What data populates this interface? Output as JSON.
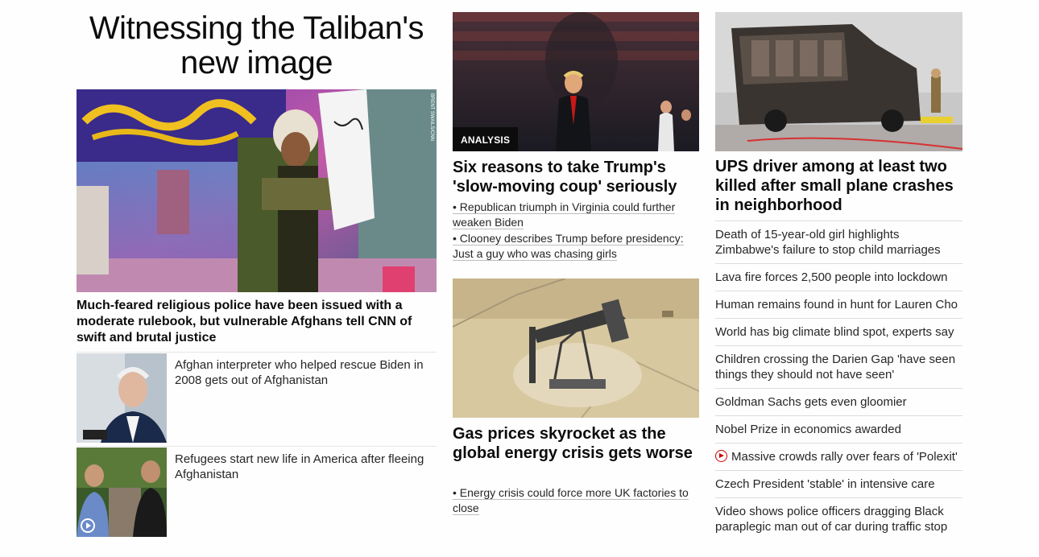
{
  "left": {
    "banner_title": "Witnessing the Taliban's new image",
    "hero": {
      "credit": "BRENT SWAILS/CNN",
      "caption": "Much-feared religious police have been issued with a moderate rulebook, but vulnerable Afghans tell CNN of swift and brutal justice"
    },
    "thumbs": [
      {
        "text": "Afghan interpreter who helped rescue Biden in 2008 gets out of Afghanistan",
        "icon": ""
      },
      {
        "text": "Refugees start new life in America after fleeing Afghanistan",
        "icon": "video-play-icon"
      }
    ]
  },
  "middle": {
    "card1": {
      "badge": "ANALYSIS",
      "title": "Six reasons to take Trump's 'slow-moving coup' seriously",
      "links": [
        "• Republican triumph in Virginia could further weaken Biden",
        "• Clooney describes Trump before presidency: Just a guy who was chasing girls"
      ]
    },
    "card2": {
      "title": "Gas prices skyrocket as the global energy crisis gets worse",
      "links": [
        "• Energy crisis could force more UK factories to close"
      ]
    }
  },
  "right": {
    "title": "UPS driver among at least two killed after small plane crashes in neighborhood",
    "items": [
      "Death of 15-year-old girl highlights Zimbabwe's failure to stop child marriages",
      "Lava fire forces 2,500 people into lockdown",
      "Human remains found in hunt for Lauren Cho",
      "World has big climate blind spot, experts say",
      "Children crossing the Darien Gap 'have seen things they should not have seen'",
      "Goldman Sachs gets even gloomier",
      "Nobel Prize in economics awarded",
      "Massive crowds rally over fears of 'Polexit'",
      "Czech President 'stable' in intensive care",
      "Video shows police officers dragging Black paraplegic man out of car during traffic stop"
    ],
    "video_item_index": 7
  },
  "colors": {
    "accent_red": "#cc0000",
    "text": "#0c0c0c",
    "divider": "#dcdcdc"
  }
}
